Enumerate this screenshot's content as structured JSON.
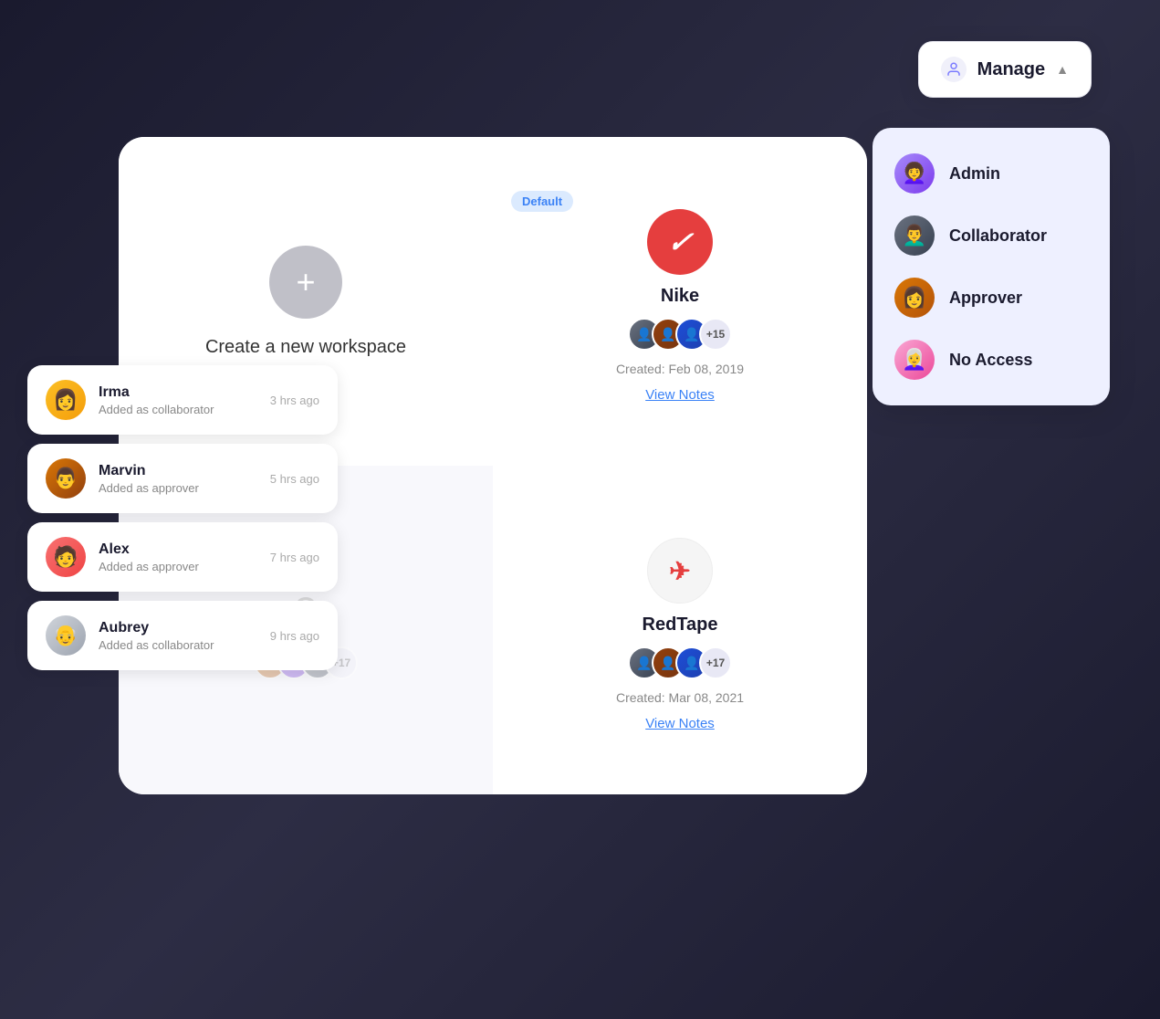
{
  "manage_button": {
    "label": "Manage",
    "chevron": "▲"
  },
  "role_dropdown": {
    "items": [
      {
        "id": "admin",
        "label": "Admin",
        "avatar_emoji": "👩‍🦱"
      },
      {
        "id": "collaborator",
        "label": "Collaborator",
        "avatar_emoji": "👨‍🦱"
      },
      {
        "id": "approver",
        "label": "Approver",
        "avatar_emoji": "👩"
      },
      {
        "id": "no-access",
        "label": "No Access",
        "avatar_emoji": "👩‍🦳"
      }
    ]
  },
  "create_workspace": {
    "label": "Create a new workspace",
    "plus_icon": "+"
  },
  "nike_workspace": {
    "badge": "Default",
    "name": "Nike",
    "created": "Created: Feb 08, 2019",
    "view_notes": "View Notes",
    "member_count": "+15"
  },
  "redtape_workspace": {
    "name": "RedTape",
    "created": "Created: Mar 08, 2021",
    "view_notes": "View Notes",
    "member_count": "+17"
  },
  "activity_items": [
    {
      "id": "irma",
      "name": "Irma",
      "desc": "Added as collaborator",
      "time": "3 hrs ago",
      "avatar_class": "av-irma",
      "emoji": "👩"
    },
    {
      "id": "marvin",
      "name": "Marvin",
      "desc": "Added as approver",
      "time": "5 hrs ago",
      "avatar_class": "av-marvin",
      "emoji": "👨"
    },
    {
      "id": "alex",
      "name": "Alex",
      "desc": "Added as approver",
      "time": "7 hrs ago",
      "avatar_class": "av-alex",
      "emoji": "🧑"
    },
    {
      "id": "aubrey",
      "name": "Aubrey",
      "desc": "Added as collaborator",
      "time": "9 hrs ago",
      "avatar_class": "av-aubrey",
      "emoji": "👴"
    }
  ],
  "colors": {
    "nike_red": "#e53e3e",
    "dropdown_bg": "#eef0ff",
    "badge_bg": "#dbeafe",
    "badge_text": "#3b82f6",
    "link_color": "#3b82f6"
  }
}
